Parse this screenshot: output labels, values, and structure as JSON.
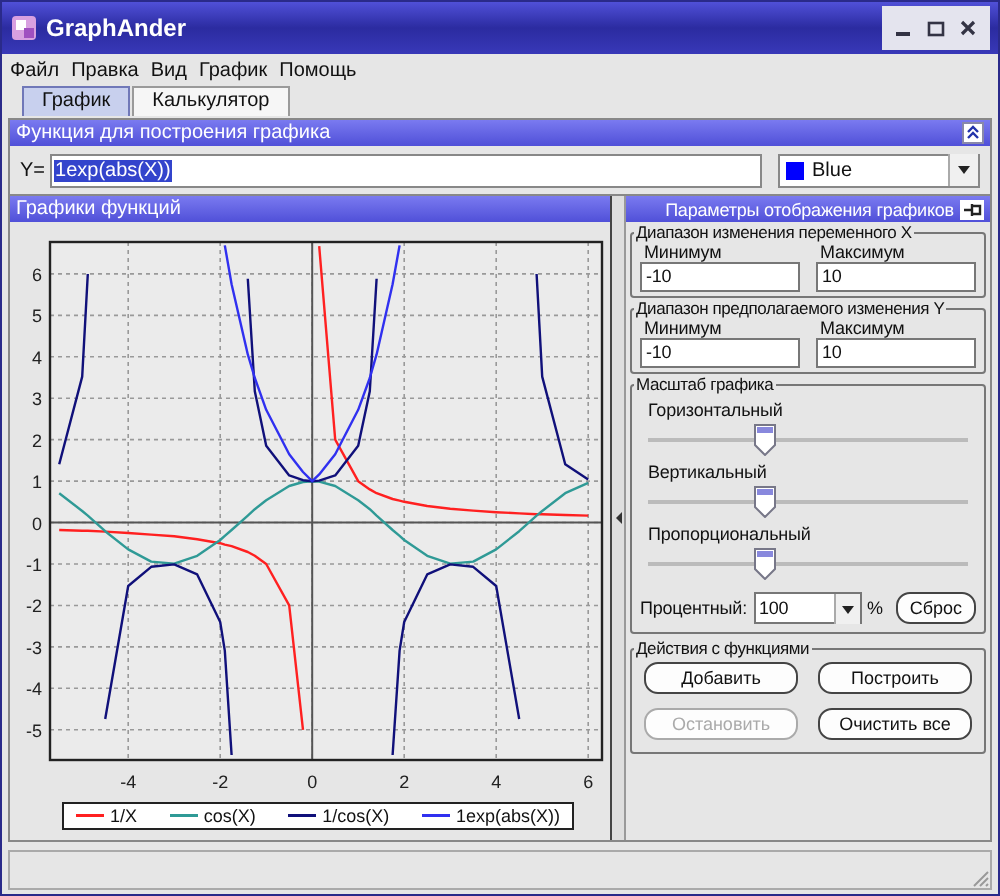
{
  "window": {
    "title": "GraphAnder"
  },
  "menu": [
    "Файл",
    "Правка",
    "Вид",
    "График",
    "Помощь"
  ],
  "tabs": [
    {
      "label": "График",
      "selected": true
    },
    {
      "label": "Калькулятор",
      "selected": false
    }
  ],
  "function_panel": {
    "title": "Функция для построения графика",
    "prefix": "Y=",
    "value": "1exp(abs(X))",
    "color_label": "Blue"
  },
  "graph_panel": {
    "title": "Графики функций",
    "chart_data": {
      "type": "line",
      "x": [
        -5.5,
        -5,
        -4.88,
        -4.5,
        -4,
        -3.5,
        -3,
        -2.5,
        -2,
        -1.9,
        -1.75,
        -1.4,
        -1.25,
        -1,
        -0.5,
        -0.2,
        0,
        0.15,
        0.5,
        1,
        1.25,
        1.4,
        1.75,
        1.9,
        2,
        2.5,
        3,
        3.5,
        4,
        4.5,
        4.88,
        5,
        5.5,
        6
      ],
      "series": [
        {
          "name": "1/X",
          "color": "#ff2020",
          "values": [
            -0.18,
            -0.2,
            -0.2,
            -0.22,
            -0.25,
            -0.29,
            -0.33,
            -0.4,
            -0.5,
            -0.53,
            -0.57,
            -0.71,
            -0.8,
            -1,
            -2,
            -5,
            null,
            6.67,
            2,
            1,
            0.8,
            0.71,
            0.57,
            0.53,
            0.5,
            0.4,
            0.33,
            0.29,
            0.25,
            0.22,
            0.2,
            0.2,
            0.18,
            0.17
          ]
        },
        {
          "name": "cos(X)",
          "color": "#2f9a96",
          "values": [
            0.71,
            0.28,
            0.17,
            -0.21,
            -0.65,
            -0.94,
            -0.99,
            -0.8,
            -0.42,
            -0.32,
            -0.18,
            0.17,
            0.32,
            0.54,
            0.88,
            0.98,
            1,
            0.99,
            0.88,
            0.54,
            0.32,
            0.17,
            -0.18,
            -0.32,
            -0.42,
            -0.8,
            -0.99,
            -0.94,
            -0.65,
            -0.21,
            0.17,
            0.28,
            0.71,
            0.96
          ]
        },
        {
          "name": "1/cos(X)",
          "color": "#10107a",
          "values": [
            1.41,
            3.52,
            6,
            -4.74,
            -1.53,
            -1.07,
            -1.01,
            -1.25,
            -2.4,
            -3.09,
            -5.61,
            5.88,
            3.17,
            1.85,
            1.14,
            1.02,
            1,
            1.01,
            1.14,
            1.85,
            3.17,
            5.88,
            -5.61,
            -3.09,
            -2.4,
            -1.25,
            -1.01,
            -1.07,
            -1.53,
            -4.74,
            6,
            3.52,
            1.41,
            1.04
          ]
        },
        {
          "name": "1exp(abs(X))",
          "color": "#3030f0",
          "values": [
            null,
            null,
            null,
            null,
            null,
            null,
            null,
            null,
            null,
            6.69,
            5.75,
            4.06,
            3.49,
            2.72,
            1.65,
            1.22,
            1,
            1.16,
            1.65,
            2.72,
            3.49,
            4.06,
            5.75,
            6.69,
            null,
            null,
            null,
            null,
            null,
            null,
            null,
            null,
            null,
            null
          ]
        }
      ],
      "xlim": [
        -5.7,
        6.3
      ],
      "ylim": [
        -5.73,
        6.77
      ],
      "xticks": [
        -4,
        -2,
        0,
        2,
        4,
        6
      ],
      "yticks": [
        -5,
        -4,
        -3,
        -2,
        -1,
        0,
        1,
        2,
        3,
        4,
        5,
        6
      ],
      "grid": true
    }
  },
  "settings_panel": {
    "title": "Параметры отображения графиков",
    "ranges": [
      {
        "title": "Диапазон изменения переменного X",
        "min_label": "Минимум",
        "min_value": "-10",
        "max_label": "Максимум",
        "max_value": "10"
      },
      {
        "title": "Диапазон предполагаемого изменения Y",
        "min_label": "Минимум",
        "min_value": "-10",
        "max_label": "Максимум",
        "max_value": "10"
      }
    ],
    "scale": {
      "title": "Масштаб графика",
      "sliders": [
        {
          "label": "Горизонтальный",
          "level": 0.36
        },
        {
          "label": "Вертикальный",
          "level": 0.36
        },
        {
          "label": "Пропорциональный",
          "level": 0.36
        }
      ],
      "percent_label": "Процентный:",
      "percent_value": "100",
      "unit": "%",
      "reset": "Сброс"
    },
    "actions": {
      "title": "Действия с функциями",
      "buttons": [
        {
          "label": "Добавить",
          "disabled": false
        },
        {
          "label": "Построить",
          "disabled": false
        },
        {
          "label": "Остановить",
          "disabled": true
        },
        {
          "label": "Очистить все",
          "disabled": false
        }
      ]
    }
  }
}
